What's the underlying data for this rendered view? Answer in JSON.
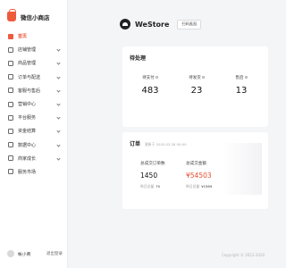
{
  "sidebar": {
    "brand_title": "微信小商店",
    "items": [
      {
        "label": "首页",
        "icon": "home-icon",
        "active": true
      },
      {
        "label": "店铺管理",
        "icon": "shop-icon"
      },
      {
        "label": "商品管理",
        "icon": "goods-icon"
      },
      {
        "label": "订单与配送",
        "icon": "order-icon"
      },
      {
        "label": "客服与售后",
        "icon": "service-icon"
      },
      {
        "label": "营销中心",
        "icon": "marketing-icon"
      },
      {
        "label": "平台服务",
        "icon": "platform-icon"
      },
      {
        "label": "资金结算",
        "icon": "funds-icon"
      },
      {
        "label": "数据中心",
        "icon": "data-icon"
      },
      {
        "label": "商家成长",
        "icon": "growth-icon"
      },
      {
        "label": "服务市场",
        "icon": "market-icon"
      }
    ],
    "user_name": "帐小商",
    "logout_label": "退出登录"
  },
  "header": {
    "store_name": "WeStore",
    "scan_button": "扫码逛逛"
  },
  "pending": {
    "title": "待处理",
    "items": [
      {
        "label": "待支付",
        "value": "483"
      },
      {
        "label": "待发货",
        "value": "23"
      },
      {
        "label": "售后",
        "value": "13"
      }
    ]
  },
  "orders": {
    "title": "订单",
    "subtitle": "更新于 2020.03.28 00:00",
    "total_count_label": "总成交订单数",
    "total_count_value": "1450",
    "total_count_prev_label": "昨日总量",
    "total_count_prev_value": "70",
    "total_amount_label": "总成交金额",
    "total_amount_value": "¥54503",
    "total_amount_prev_label": "昨日总量",
    "total_amount_prev_value": "¥1569",
    "accent_color": "#e64b2e"
  },
  "footer": {
    "copyright": "Copyright © 2012-2020"
  },
  "colors": {
    "accent": "#ee5a3c",
    "background": "#f4f5f7"
  }
}
